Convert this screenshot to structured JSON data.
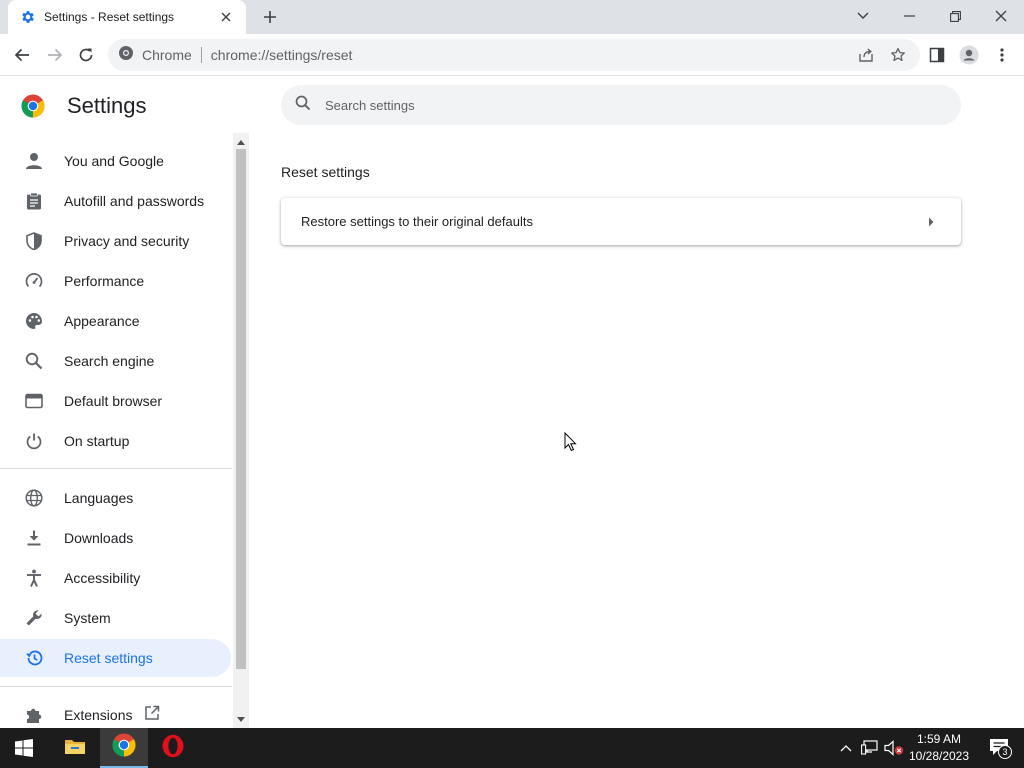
{
  "browser": {
    "tab_title": "Settings - Reset settings",
    "chip_label": "Chrome",
    "url": "chrome://settings/reset"
  },
  "settings": {
    "title": "Settings",
    "search_placeholder": "Search settings"
  },
  "sidebar": {
    "items": [
      {
        "label": "You and Google",
        "icon": "person-icon"
      },
      {
        "label": "Autofill and passwords",
        "icon": "clipboard-icon"
      },
      {
        "label": "Privacy and security",
        "icon": "shield-icon"
      },
      {
        "label": "Performance",
        "icon": "speedometer-icon"
      },
      {
        "label": "Appearance",
        "icon": "palette-icon"
      },
      {
        "label": "Search engine",
        "icon": "search-icon"
      },
      {
        "label": "Default browser",
        "icon": "browser-window-icon"
      },
      {
        "label": "On startup",
        "icon": "power-icon"
      },
      {
        "label": "Languages",
        "icon": "globe-icon"
      },
      {
        "label": "Downloads",
        "icon": "download-icon"
      },
      {
        "label": "Accessibility",
        "icon": "accessibility-icon"
      },
      {
        "label": "System",
        "icon": "wrench-icon"
      },
      {
        "label": "Reset settings",
        "icon": "history-icon",
        "active": true
      },
      {
        "label": "Extensions",
        "icon": "puzzle-icon"
      }
    ]
  },
  "main": {
    "section_title": "Reset settings",
    "restore_label": "Restore settings to their original defaults"
  },
  "taskbar": {
    "time": "1:59 AM",
    "date": "10/28/2023",
    "notification_count": "3"
  },
  "colors": {
    "accent": "#1a73e8",
    "active_nav_bg": "#e8f0fe",
    "tab_strip": "#dee1e6",
    "taskbar": "#1c1c1c"
  }
}
